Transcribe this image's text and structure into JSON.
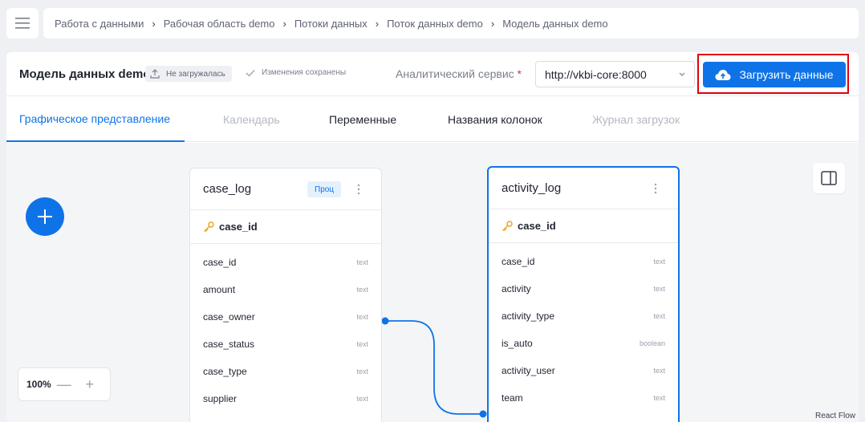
{
  "breadcrumb": [
    "Работа с данными",
    "Рабочая область demo",
    "Потоки данных",
    "Поток данных demo",
    "Модель данных demo"
  ],
  "header": {
    "title": "Модель данных demo",
    "load_status": "Не загружалась",
    "save_status": "Изменения сохранены",
    "service_label": "Аналитический сервис",
    "required_mark": "*",
    "service_value": "http://vkbi-core:8000",
    "upload_label": "Загрузить данные"
  },
  "tabs": [
    {
      "label": "Графическое представление",
      "state": "active"
    },
    {
      "label": "Календарь",
      "state": "disabled"
    },
    {
      "label": "Переменные",
      "state": "normal"
    },
    {
      "label": "Названия колонок",
      "state": "normal"
    },
    {
      "label": "Журнал загрузок",
      "state": "disabled"
    }
  ],
  "zoom": {
    "level": "100%",
    "minus": "—",
    "plus": "+"
  },
  "attribution": "React Flow",
  "tables": [
    {
      "name": "case_log",
      "badge": "Проц",
      "key": "case_id",
      "columns": [
        {
          "name": "case_id",
          "type": "text"
        },
        {
          "name": "amount",
          "type": "text"
        },
        {
          "name": "case_owner",
          "type": "text"
        },
        {
          "name": "case_status",
          "type": "text"
        },
        {
          "name": "case_type",
          "type": "text"
        },
        {
          "name": "supplier",
          "type": "text"
        }
      ]
    },
    {
      "name": "activity_log",
      "badge": "",
      "key": "case_id",
      "columns": [
        {
          "name": "case_id",
          "type": "text"
        },
        {
          "name": "activity",
          "type": "text"
        },
        {
          "name": "activity_type",
          "type": "text"
        },
        {
          "name": "is_auto",
          "type": "boolean"
        },
        {
          "name": "activity_user",
          "type": "text"
        },
        {
          "name": "team",
          "type": "text"
        }
      ]
    }
  ],
  "colors": {
    "accent": "#0f73e8",
    "highlight": "#e0000f",
    "key": "#e8a317"
  }
}
